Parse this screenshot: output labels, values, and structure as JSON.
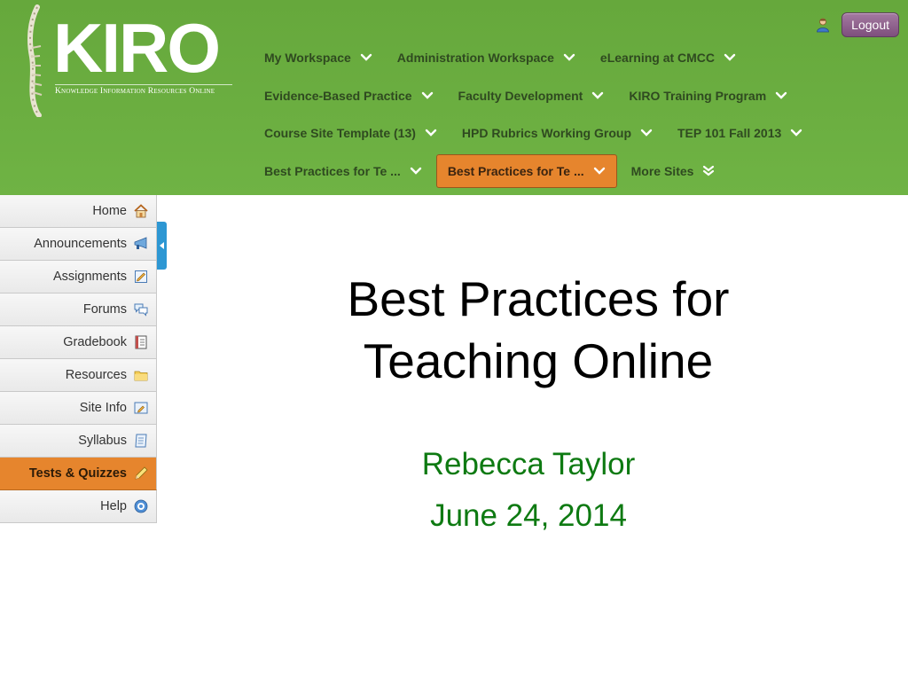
{
  "brand": {
    "logo_text": "KIRO",
    "logo_tagline": "Knowledge Information Resources Online",
    "header_color": "#6bb040",
    "accent_color": "#e6852d"
  },
  "header": {
    "user_icon": "user-icon",
    "logout_label": "Logout"
  },
  "sites": {
    "rows": [
      [
        {
          "label": "My Workspace",
          "icon": "chevron-down-icon"
        },
        {
          "label": "Administration Workspace",
          "icon": "chevron-down-icon"
        },
        {
          "label": "eLearning at CMCC",
          "icon": "chevron-down-icon"
        }
      ],
      [
        {
          "label": "Evidence-Based Practice",
          "icon": "chevron-down-icon"
        },
        {
          "label": "Faculty Development",
          "icon": "chevron-down-icon"
        },
        {
          "label": "KIRO Training Program",
          "icon": "chevron-down-icon"
        }
      ],
      [
        {
          "label": "Course Site Template (13)",
          "icon": "chevron-down-icon"
        },
        {
          "label": "HPD Rubrics Working Group",
          "icon": "chevron-down-icon"
        },
        {
          "label": "TEP 101 Fall 2013",
          "icon": "chevron-down-icon"
        }
      ],
      [
        {
          "label": "Best Practices for Te ...",
          "icon": "chevron-down-icon"
        },
        {
          "label": "Best Practices for Te ...",
          "icon": "chevron-down-icon",
          "current": true
        },
        {
          "label": "More Sites",
          "icon": "double-chevron-down-icon"
        }
      ]
    ]
  },
  "tools": [
    {
      "label": "Home",
      "icon": "home-icon"
    },
    {
      "label": "Announcements",
      "icon": "megaphone-icon"
    },
    {
      "label": "Assignments",
      "icon": "assignment-icon"
    },
    {
      "label": "Forums",
      "icon": "forums-icon"
    },
    {
      "label": "Gradebook",
      "icon": "gradebook-icon"
    },
    {
      "label": "Resources",
      "icon": "folder-icon"
    },
    {
      "label": "Site Info",
      "icon": "site-info-icon"
    },
    {
      "label": "Syllabus",
      "icon": "syllabus-icon"
    },
    {
      "label": "Tests & Quizzes",
      "icon": "pencil-icon",
      "active": true
    },
    {
      "label": "Help",
      "icon": "help-icon"
    }
  ],
  "main": {
    "title_line1": "Best Practices for",
    "title_line2": "Teaching Online",
    "presenter": "Rebecca Taylor",
    "date": "June 24, 2014"
  }
}
